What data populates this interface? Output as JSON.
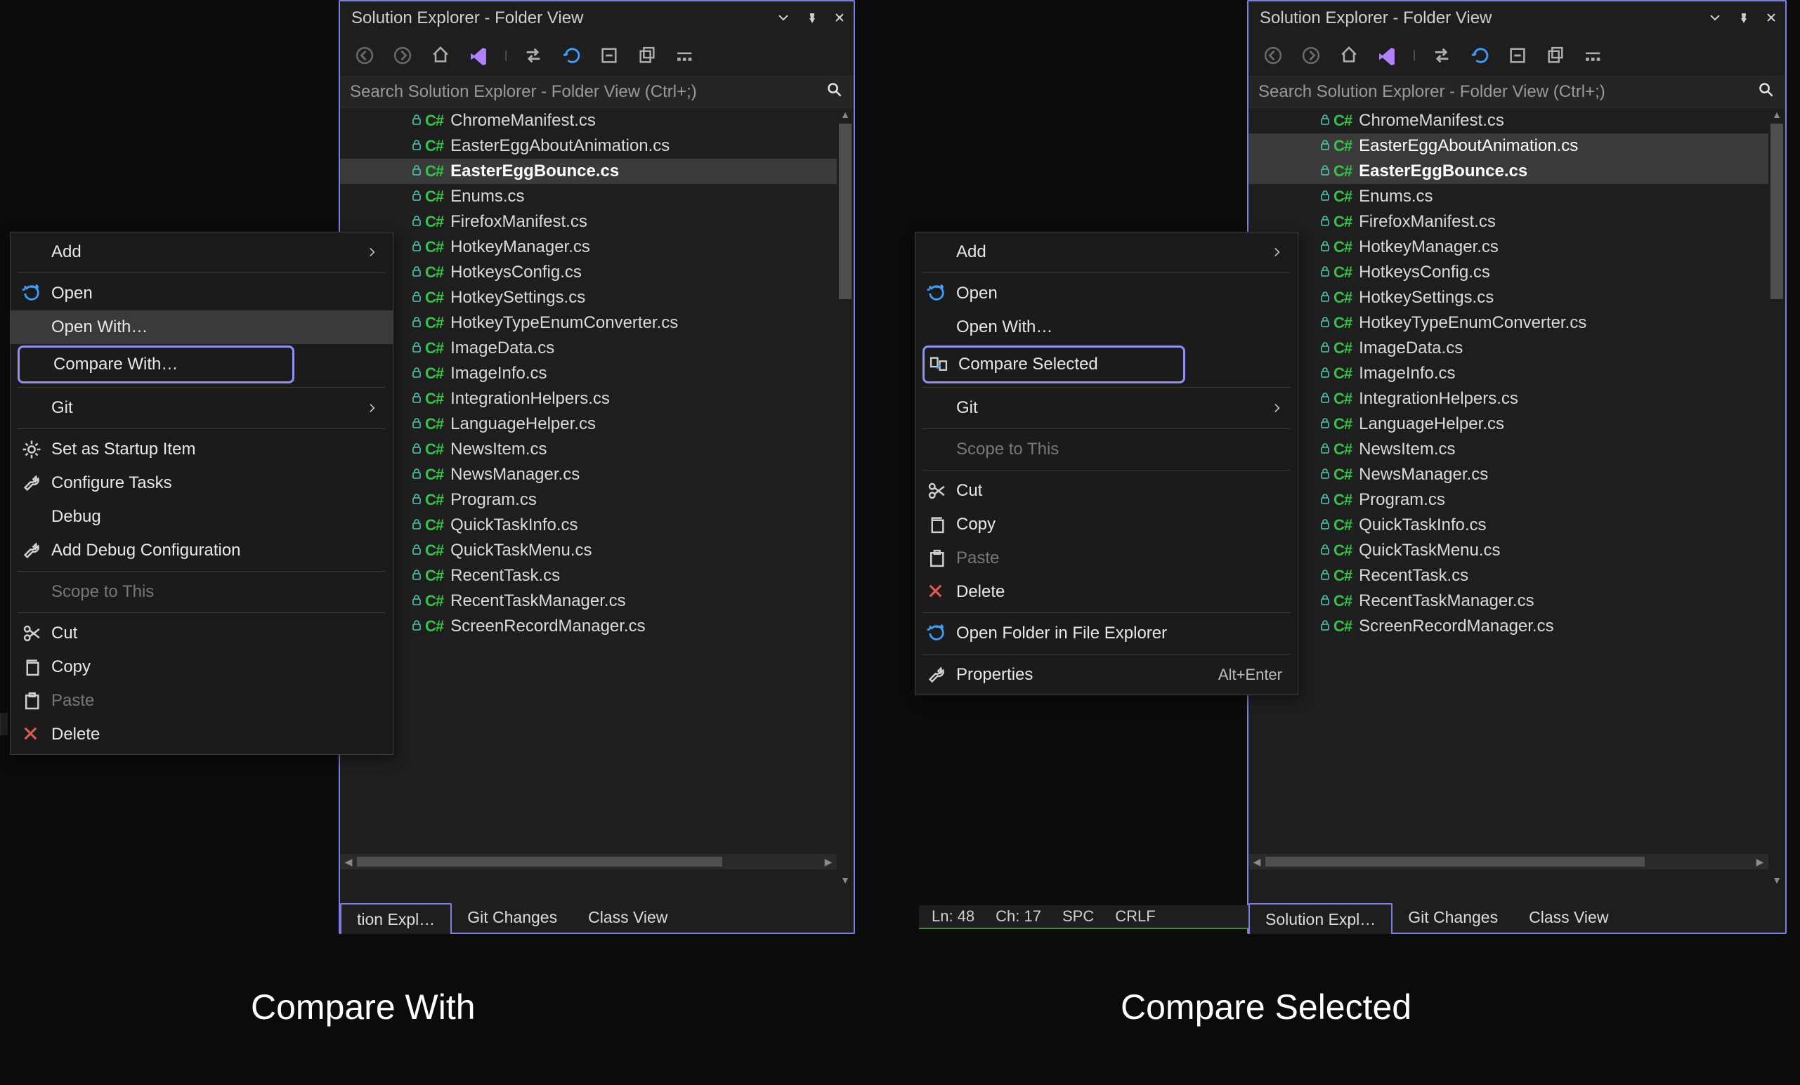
{
  "panel_title": "Solution Explorer - Folder View",
  "search_placeholder": "Search Solution Explorer - Folder View (Ctrl+;)",
  "files": [
    "ChromeManifest.cs",
    "EasterEggAboutAnimation.cs",
    "EasterEggBounce.cs",
    "Enums.cs",
    "FirefoxManifest.cs",
    "HotkeyManager.cs",
    "HotkeysConfig.cs",
    "HotkeySettings.cs",
    "HotkeyTypeEnumConverter.cs",
    "ImageData.cs",
    "ImageInfo.cs",
    "IntegrationHelpers.cs",
    "LanguageHelper.cs",
    "NewsItem.cs",
    "NewsManager.cs",
    "Program.cs",
    "QuickTaskInfo.cs",
    "QuickTaskMenu.cs",
    "RecentTask.cs",
    "RecentTaskManager.cs",
    "ScreenRecordManager.cs"
  ],
  "tabs": {
    "left": {
      "active": "tion Expl…",
      "items": [
        "tion Expl…",
        "Git Changes",
        "Class View"
      ]
    },
    "right": {
      "active": "Solution Expl…",
      "items": [
        "Solution Expl…",
        "Git Changes",
        "Class View"
      ]
    }
  },
  "ctx_left": {
    "add": "Add",
    "open": "Open",
    "open_with": "Open With…",
    "compare_with": "Compare With…",
    "git": "Git",
    "set_startup": "Set as Startup Item",
    "configure_tasks": "Configure Tasks",
    "debug": "Debug",
    "add_debug_cfg": "Add Debug Configuration",
    "scope": "Scope to This",
    "cut": "Cut",
    "copy": "Copy",
    "paste": "Paste",
    "delete": "Delete"
  },
  "ctx_right": {
    "add": "Add",
    "open": "Open",
    "open_with": "Open With…",
    "compare_selected": "Compare Selected",
    "git": "Git",
    "scope": "Scope to This",
    "cut": "Cut",
    "copy": "Copy",
    "paste": "Paste",
    "delete": "Delete",
    "open_folder": "Open Folder in File Explorer",
    "properties": "Properties",
    "properties_shortcut": "Alt+Enter"
  },
  "status_right": {
    "ln": "Ln: 48",
    "ch": "Ch: 17",
    "spc": "SPC",
    "crlf": "CRLF"
  },
  "captions": {
    "left": "Compare With",
    "right": "Compare Selected"
  }
}
